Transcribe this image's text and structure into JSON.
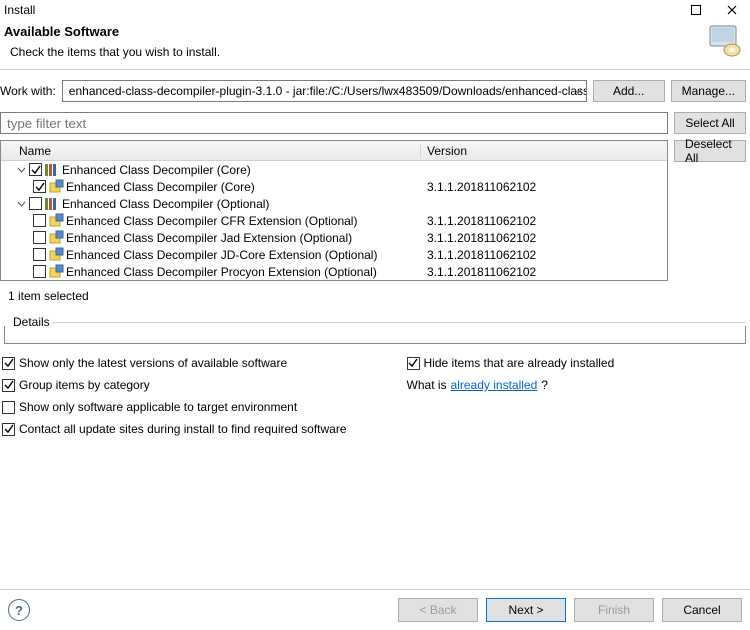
{
  "window": {
    "title": "Install"
  },
  "banner": {
    "title": "Available Software",
    "subtitle": "Check the items that you wish to install."
  },
  "workwith": {
    "label": "Work with:",
    "value": "enhanced-class-decompiler-plugin-3.1.0 - jar:file:/C:/Users/lwx483509/Downloads/enhanced-class",
    "add_btn": "Add...",
    "manage_btn": "Manage..."
  },
  "filter": {
    "placeholder": "type filter text",
    "select_all_btn": "Select All",
    "deselect_all_btn": "Deselect All"
  },
  "columns": {
    "name": "Name",
    "version": "Version"
  },
  "tree": [
    {
      "type": "category",
      "expanded": true,
      "checked": "checked",
      "label": "Enhanced Class Decompiler (Core)",
      "children": [
        {
          "type": "feature",
          "checked": "checked",
          "label": "Enhanced Class Decompiler (Core)",
          "version": "3.1.1.201811062102"
        }
      ]
    },
    {
      "type": "category",
      "expanded": true,
      "checked": "unchecked",
      "label": "Enhanced Class Decompiler (Optional)",
      "children": [
        {
          "type": "feature",
          "checked": "unchecked",
          "label": "Enhanced Class Decompiler CFR Extension (Optional)",
          "version": "3.1.1.201811062102"
        },
        {
          "type": "feature",
          "checked": "unchecked",
          "label": "Enhanced Class Decompiler Jad Extension (Optional)",
          "version": "3.1.1.201811062102"
        },
        {
          "type": "feature",
          "checked": "unchecked",
          "label": "Enhanced Class Decompiler JD-Core Extension (Optional)",
          "version": "3.1.1.201811062102"
        },
        {
          "type": "feature",
          "checked": "unchecked",
          "label": "Enhanced Class Decompiler Procyon Extension (Optional)",
          "version": "3.1.1.201811062102"
        }
      ]
    }
  ],
  "status": "1 item selected",
  "details": {
    "label": "Details"
  },
  "options": {
    "latest": "Show only the latest versions of available software",
    "group": "Group items by category",
    "target_env": "Show only software applicable to target environment",
    "contact": "Contact all update sites during install to find required software",
    "hide_installed": "Hide items that are already installed",
    "whatis_prefix": "What is ",
    "whatis_link": "already installed",
    "whatis_suffix": "?",
    "checked": {
      "latest": true,
      "group": true,
      "target_env": false,
      "contact": true,
      "hide_installed": true
    }
  },
  "footer": {
    "back": "< Back",
    "next": "Next >",
    "finish": "Finish",
    "cancel": "Cancel"
  }
}
